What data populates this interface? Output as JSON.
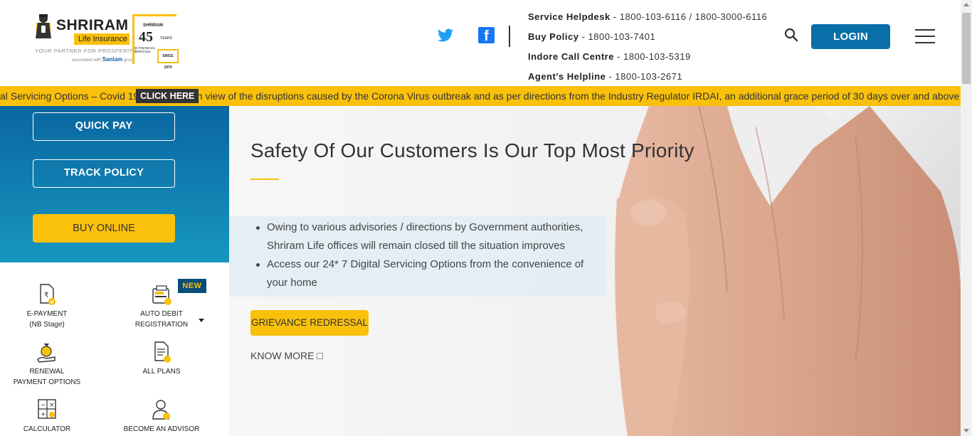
{
  "header": {
    "logo": {
      "brand": "SHRIRAM",
      "brand_sub": "Life Insurance",
      "tagline": "YOUR PARTNER FOR PROSPERITY",
      "assoc_prefix": "associated with",
      "assoc_partner": "Sanlam",
      "assoc_suffix": "group",
      "badge_top": "SHRIRAM",
      "badge_number": "45",
      "badge_years": "YEARS",
      "badge_financial": "IN FINANCIAL SERVICES",
      "badge_since": "SINCE 1974"
    },
    "social": {
      "twitter_icon": "twitter-icon",
      "facebook_icon": "facebook-icon",
      "facebook_glyph": "f"
    },
    "contacts": [
      {
        "label": "Service Helpdesk",
        "value": " - 1800-103-6116 / 1800-3000-6116"
      },
      {
        "label": "Buy Policy",
        "value": " - 1800-103-7401"
      },
      {
        "label": "Indore Call Centre",
        "value": " - 1800-103-5319"
      },
      {
        "label": "Agent's Helpline",
        "value": " - 1800-103-2671"
      }
    ],
    "login_label": "LOGIN"
  },
  "ticker": {
    "prefix": "al Servicing Options – Covid 19",
    "click_label": "CLICK HERE",
    "message": "In view of the disruptions caused by the Corona Virus outbreak and as per directions from the Industry Regulator IRDAI, an additional grace period of 30 days over and above the r"
  },
  "left_panel": {
    "quick_pay": "QUICK PAY",
    "track_policy": "TRACK POLICY",
    "buy_online": "BUY ONLINE",
    "new_tag": "NEW",
    "services": [
      {
        "line1": "E-PAYMENT",
        "line2": "(NB Stage)",
        "icon": "rupee-document-icon"
      },
      {
        "line1": "AUTO DEBIT",
        "line2": "REGISTRATION",
        "icon": "card-machine-icon"
      },
      {
        "line1": "RENEWAL",
        "line2": "PAYMENT OPTIONS",
        "icon": "money-bag-hand-icon"
      },
      {
        "line1": "ALL PLANS",
        "line2": "",
        "icon": "document-list-icon"
      },
      {
        "line1": "CALCULATOR",
        "line2": "",
        "icon": "calculator-icon"
      },
      {
        "line1": "BECOME AN ADVISOR",
        "line2": "",
        "icon": "person-check-icon"
      }
    ]
  },
  "hero": {
    "title": "Safety Of Our Customers Is Our Top Most Priority",
    "bullets": [
      "Owing to various advisories / directions by Government authorities, Shriram Life offices will remain closed till the situation improves",
      "Access our 24* 7 Digital Servicing Options from the convenience of your home"
    ],
    "grievance_label": "GRIEVANCE REDRESSAL",
    "know_more_label": "KNOW MORE ",
    "know_more_glyph": "□"
  },
  "colors": {
    "accent_yellow": "#f9c00c",
    "brand_blue": "#0a6ea8",
    "dark_text": "#333333"
  }
}
